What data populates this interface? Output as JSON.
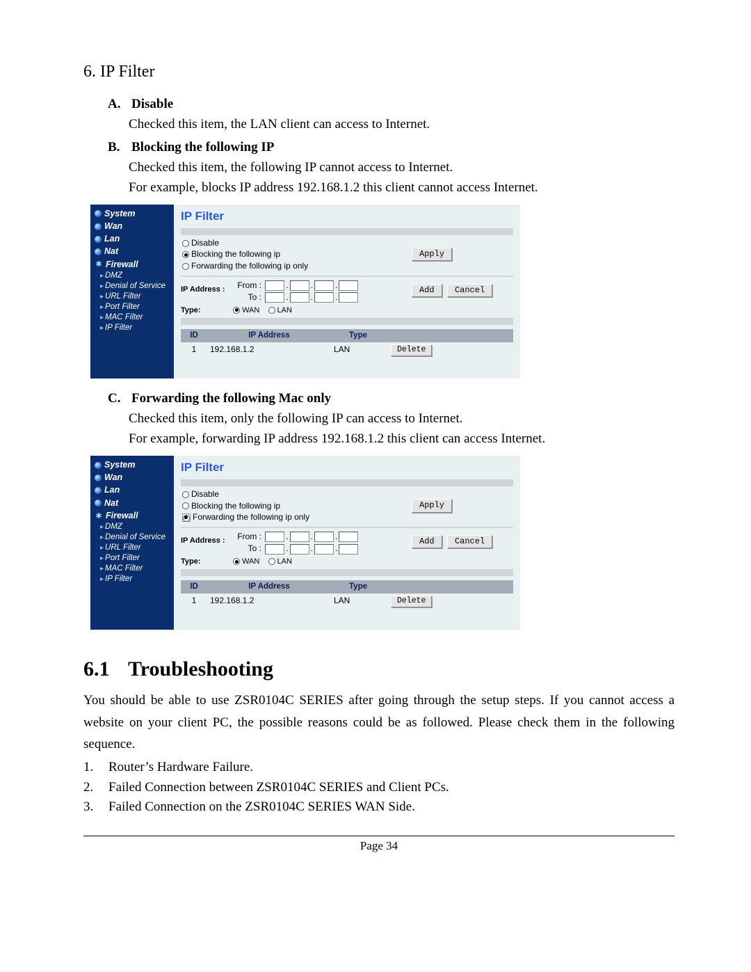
{
  "section_heading": "6.  IP Filter",
  "items": {
    "A": {
      "title": "Disable",
      "lines": [
        "Checked this item, the LAN client can access to Internet."
      ]
    },
    "B": {
      "title": "Blocking the following IP",
      "lines": [
        "Checked this item, the following IP cannot access to Internet.",
        "For example, blocks IP address 192.168.1.2 this client cannot access Internet."
      ]
    },
    "C": {
      "title": "Forwarding the following Mac only",
      "lines": [
        "Checked this item, only the following IP can access to Internet.",
        "For example, forwarding IP address 192.168.1.2 this client can access Internet."
      ]
    }
  },
  "router": {
    "title": "IP Filter",
    "sidebar": {
      "items": [
        "System",
        "Wan",
        "Lan",
        "Nat"
      ],
      "firewall": "Firewall",
      "subs": [
        "DMZ",
        "Denial of Service",
        "URL Filter",
        "Port Filter",
        "MAC Filter",
        "IP Filter"
      ]
    },
    "radios": {
      "disable": "Disable",
      "blocking": "Blocking the following ip",
      "forwarding": "Forwarding the following ip only"
    },
    "buttons": {
      "apply": "Apply",
      "add": "Add",
      "cancel": "Cancel",
      "delete": "Delete"
    },
    "labels": {
      "ip_address": "IP Address :",
      "from": "From :",
      "to": "To    :",
      "type": "Type:",
      "wan": "WAN",
      "lan": "LAN"
    },
    "table": {
      "headers": {
        "id": "ID",
        "ip": "IP Address",
        "type": "Type"
      },
      "row": {
        "id": "1",
        "ip": "192.168.1.2",
        "type": "LAN"
      }
    }
  },
  "troubleshooting": {
    "num": "6.1",
    "title": "Troubleshooting",
    "para": "You should be able to use ZSR0104C SERIES after going through the setup steps. If you cannot access a website on your client PC, the possible reasons could be as followed. Please check them in the following sequence.",
    "steps": [
      "Router’s Hardware Failure.",
      "Failed Connection between ZSR0104C SERIES and Client PCs.",
      "Failed Connection on the ZSR0104C SERIES WAN Side."
    ]
  },
  "footer": "Page 34"
}
